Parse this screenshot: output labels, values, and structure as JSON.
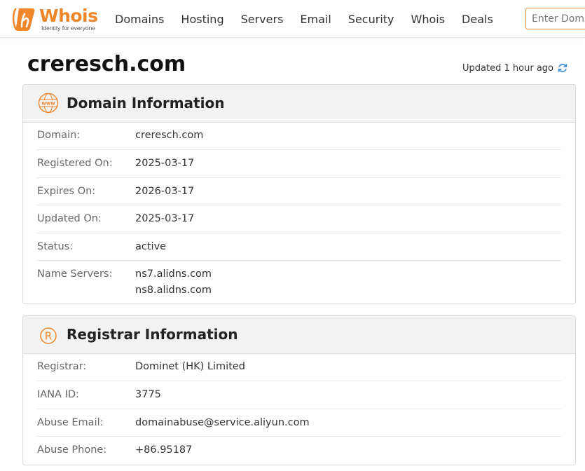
{
  "header": {
    "logo_word": "Whois",
    "logo_tagline": "Identity for everyone",
    "nav": [
      "Domains",
      "Hosting",
      "Servers",
      "Email",
      "Security",
      "Whois",
      "Deals"
    ],
    "search_placeholder": "Enter Domain"
  },
  "page": {
    "title": "creresch.com",
    "updated_prefix": "Updated",
    "updated_value": "1 hour ago"
  },
  "domain_info": {
    "title": "Domain Information",
    "rows": [
      {
        "label": "Domain:",
        "value": "creresch.com"
      },
      {
        "label": "Registered On:",
        "value": "2025-03-17"
      },
      {
        "label": "Expires On:",
        "value": "2026-03-17"
      },
      {
        "label": "Updated On:",
        "value": "2025-03-17"
      },
      {
        "label": "Status:",
        "value": "active"
      }
    ],
    "name_servers_label": "Name Servers:",
    "name_servers": [
      "ns7.alidns.com",
      "ns8.alidns.com"
    ]
  },
  "registrar_info": {
    "title": "Registrar Information",
    "rows": [
      {
        "label": "Registrar:",
        "value": "Dominet (HK) Limited"
      },
      {
        "label": "IANA ID:",
        "value": "3775"
      },
      {
        "label": "Abuse Email:",
        "value": "domainabuse@service.aliyun.com"
      },
      {
        "label": "Abuse Phone:",
        "value": "+86.95187"
      }
    ]
  },
  "colors": {
    "brand": "#f0862a",
    "refresh_icon": "#3b8fd6"
  },
  "icons": {
    "logo": "whois-logo-icon",
    "refresh": "refresh-icon",
    "domain_card": "www-globe-icon",
    "registrar_card": "registered-mark-icon"
  }
}
